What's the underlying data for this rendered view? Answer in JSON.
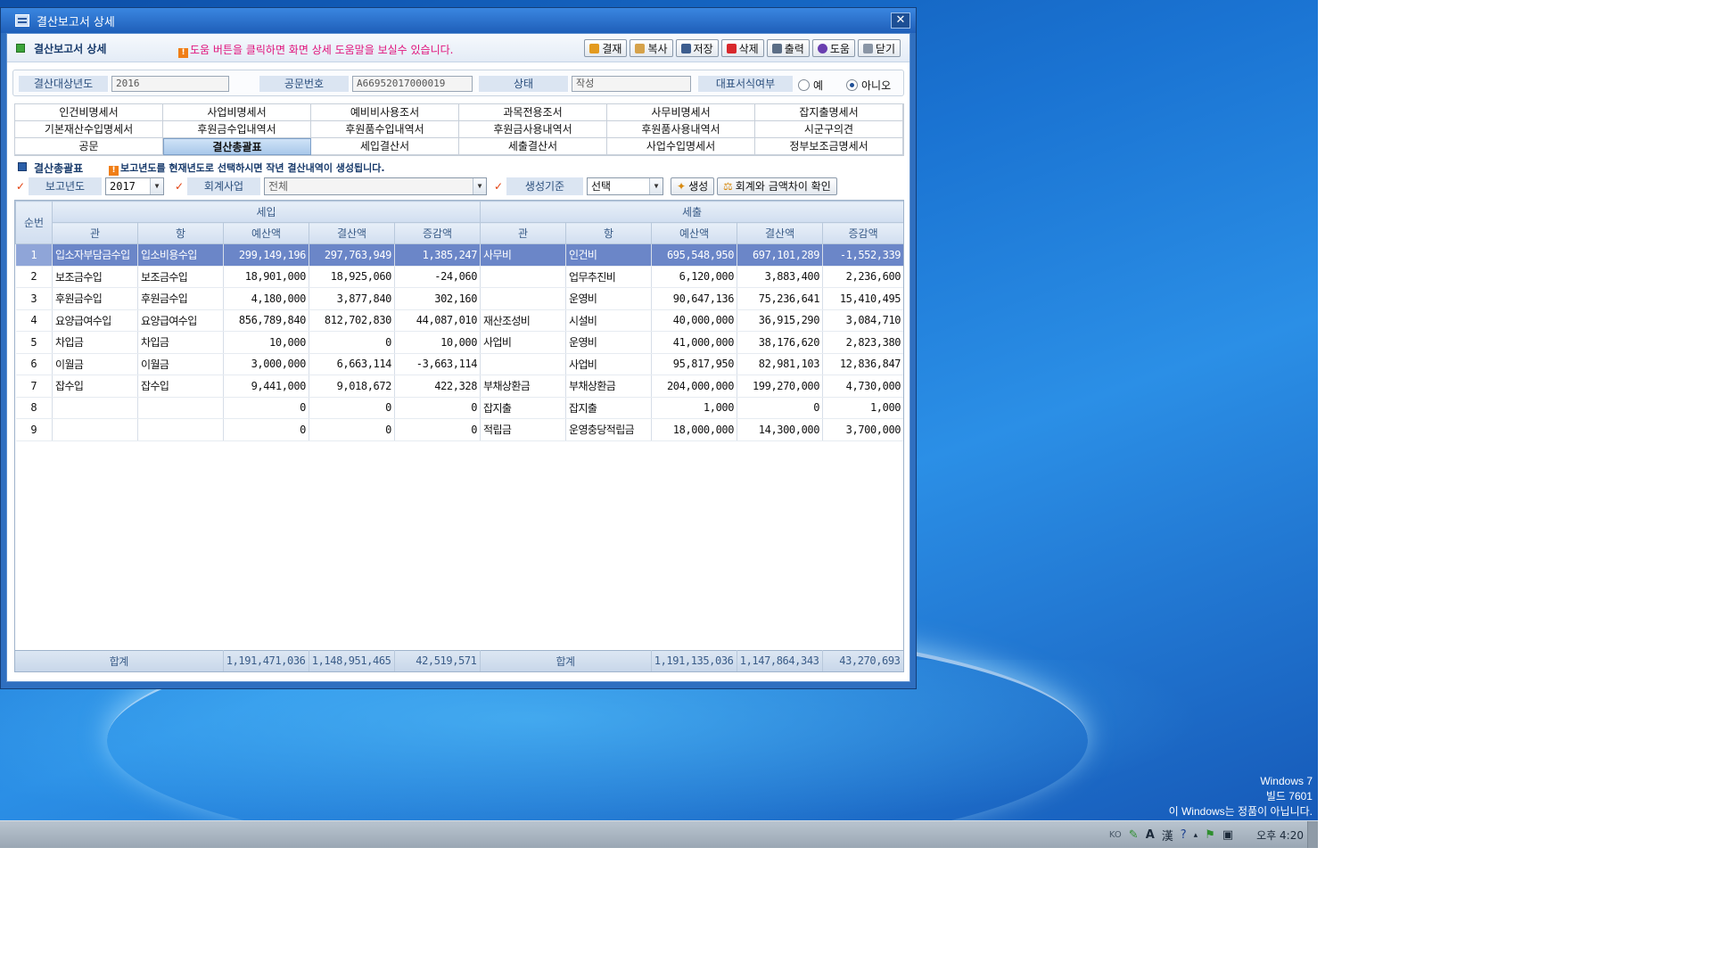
{
  "watermark": {
    "line1": "Windows 7",
    "line2": "빌드 7601",
    "line3": "이 Windows는 정품이 아닙니다."
  },
  "tray": {
    "lang": "KO",
    "ime_a": "A",
    "ime_han": "漢",
    "clock": "오후 4:20"
  },
  "window": {
    "title": "결산보고서 상세",
    "close": "✕"
  },
  "header": {
    "title": "결산보고서 상세",
    "help_icon": "!",
    "help_msg": "도움 버튼을 클릭하면 화면 상세 도움말을 보실수 있습니다.",
    "buttons": [
      "결재",
      "복사",
      "저장",
      "삭제",
      "출력",
      "도움",
      "닫기"
    ]
  },
  "info": {
    "year_label": "결산대상년도",
    "year_value": "2016",
    "doc_label": "공문번호",
    "doc_value": "A66952017000019",
    "status_label": "상태",
    "status_value": "작성",
    "rep_label": "대표서식여부",
    "opt_yes": "예",
    "opt_no": "아니오",
    "selected": "아니오"
  },
  "tabs": [
    "인건비명세서",
    "사업비명세서",
    "예비비사용조서",
    "과목전용조서",
    "사무비명세서",
    "잡지출명세서",
    "기본재산수입명세서",
    "후원금수입내역서",
    "후원품수입내역서",
    "후원금사용내역서",
    "후원품사용내역서",
    "시군구의견",
    "공문",
    "결산총괄표",
    "세입결산서",
    "세출결산서",
    "사업수입명세서",
    "정부보조금명세서"
  ],
  "active_tab": "결산총괄표",
  "sub": {
    "title": "결산총괄표",
    "msg": "보고년도를 현재년도로 선택하시면 작년 결산내역이 생성됩니다."
  },
  "filter": {
    "check": "✓",
    "year_label": "보고년도",
    "year_value": "2017",
    "biz_label": "회계사업",
    "biz_value": "전체",
    "base_label": "생성기준",
    "base_value": "선택",
    "gen_btn": "생성",
    "diff_btn": "회계와 금액차이 확인"
  },
  "grid": {
    "seq_header": "순번",
    "income_group": "세입",
    "expense_group": "세출",
    "columns": [
      "관",
      "항",
      "예산액",
      "결산액",
      "증감액",
      "관",
      "항",
      "예산액",
      "결산액",
      "증감액"
    ],
    "rows": [
      [
        "1",
        "입소자부담금수입",
        "입소비용수입",
        "299,149,196",
        "297,763,949",
        "1,385,247",
        "사무비",
        "인건비",
        "695,548,950",
        "697,101,289",
        "-1,552,339"
      ],
      [
        "2",
        "보조금수입",
        "보조금수입",
        "18,901,000",
        "18,925,060",
        "-24,060",
        "",
        "업무추진비",
        "6,120,000",
        "3,883,400",
        "2,236,600"
      ],
      [
        "3",
        "후원금수입",
        "후원금수입",
        "4,180,000",
        "3,877,840",
        "302,160",
        "",
        "운영비",
        "90,647,136",
        "75,236,641",
        "15,410,495"
      ],
      [
        "4",
        "요양급여수입",
        "요양급여수입",
        "856,789,840",
        "812,702,830",
        "44,087,010",
        "재산조성비",
        "시설비",
        "40,000,000",
        "36,915,290",
        "3,084,710"
      ],
      [
        "5",
        "차입금",
        "차입금",
        "10,000",
        "0",
        "10,000",
        "사업비",
        "운영비",
        "41,000,000",
        "38,176,620",
        "2,823,380"
      ],
      [
        "6",
        "이월금",
        "이월금",
        "3,000,000",
        "6,663,114",
        "-3,663,114",
        "",
        "사업비",
        "95,817,950",
        "82,981,103",
        "12,836,847"
      ],
      [
        "7",
        "잡수입",
        "잡수입",
        "9,441,000",
        "9,018,672",
        "422,328",
        "부채상환금",
        "부채상환금",
        "204,000,000",
        "199,270,000",
        "4,730,000"
      ],
      [
        "8",
        "",
        "",
        "0",
        "0",
        "0",
        "잡지출",
        "잡지출",
        "1,000",
        "0",
        "1,000"
      ],
      [
        "9",
        "",
        "",
        "0",
        "0",
        "0",
        "적립금",
        "운영충당적립금",
        "18,000,000",
        "14,300,000",
        "3,700,000"
      ]
    ],
    "selected_row": 0,
    "footer": {
      "income_label": "합계",
      "income_budget": "1,191,471,036",
      "income_settle": "1,148,951,465",
      "income_diff": "42,519,571",
      "expense_label": "합계",
      "expense_budget": "1,191,135,036",
      "expense_settle": "1,147,864,343",
      "expense_diff": "43,270,693"
    }
  },
  "colors": {
    "accent": "#2f6fc0",
    "selected_row": "#6b86c8",
    "help_text": "#e0147c",
    "desktop": "#1a73d2"
  }
}
